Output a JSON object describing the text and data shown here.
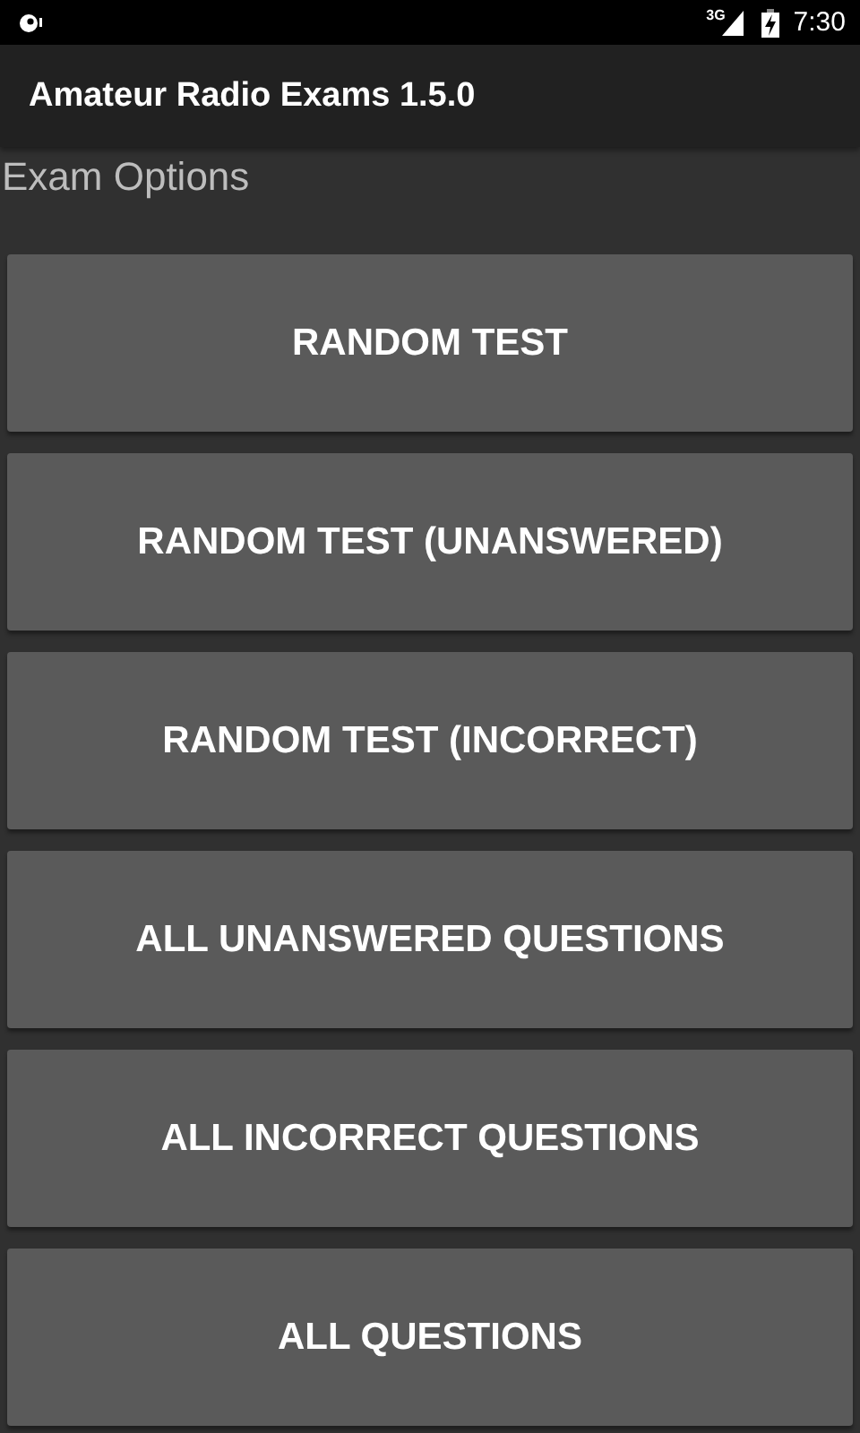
{
  "status_bar": {
    "network_type": "3G",
    "time": "7:30"
  },
  "app_bar": {
    "title": "Amateur Radio Exams 1.5.0"
  },
  "section_title": "Exam Options",
  "buttons": [
    "RANDOM TEST",
    "RANDOM TEST (UNANSWERED)",
    "RANDOM TEST (INCORRECT)",
    "ALL UNANSWERED QUESTIONS",
    "ALL INCORRECT QUESTIONS",
    "ALL QUESTIONS"
  ]
}
